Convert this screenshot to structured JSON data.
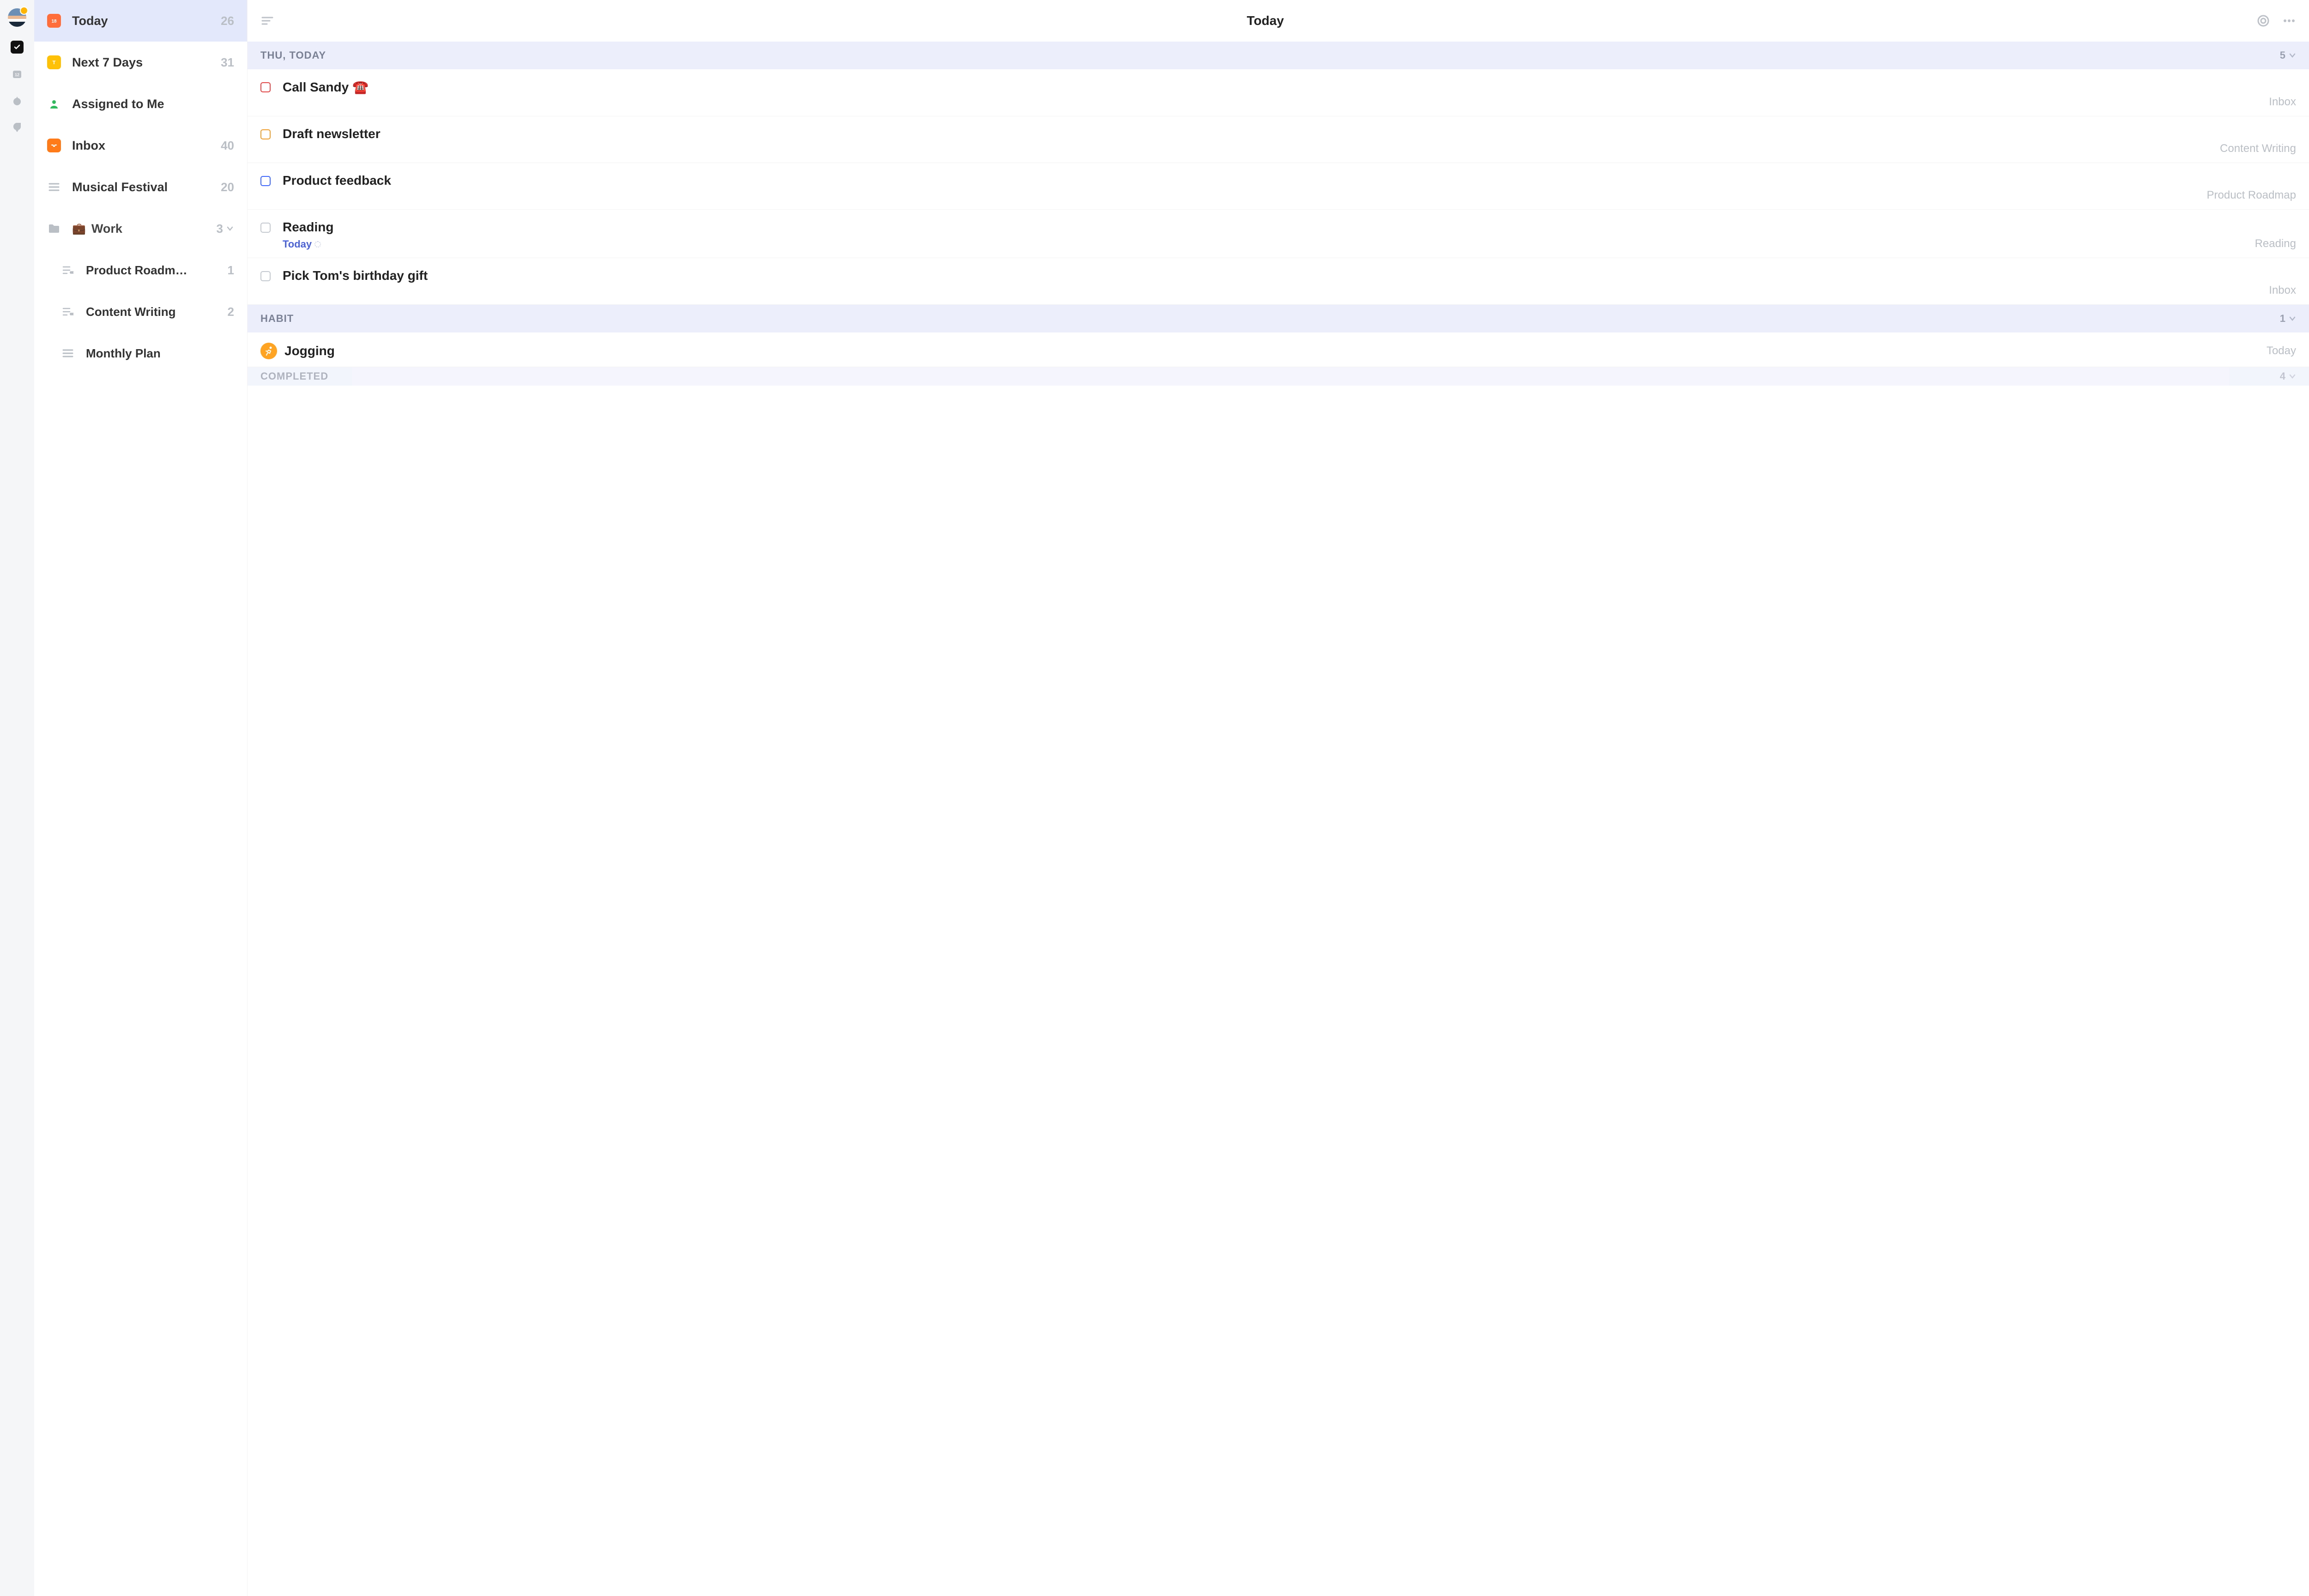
{
  "rail": {
    "items": [
      "tasks",
      "calendar",
      "star",
      "clock"
    ]
  },
  "sidebar": {
    "items": [
      {
        "label": "Today",
        "count": "26",
        "icon": "day-18",
        "color": "red",
        "selected": true
      },
      {
        "label": "Next 7 Days",
        "count": "31",
        "icon": "week",
        "color": "yellow"
      },
      {
        "label": "Assigned to Me",
        "count": "",
        "icon": "person",
        "color": "green"
      },
      {
        "label": "Inbox",
        "count": "40",
        "icon": "inbox",
        "color": "orange"
      },
      {
        "label": "Musical Festival",
        "count": "20",
        "icon": "list",
        "color": "gray"
      }
    ],
    "groups": [
      {
        "emoji": "💼",
        "label": "Work",
        "count": "3",
        "children": [
          {
            "label": "Product Roadm…",
            "count": "1"
          },
          {
            "label": "Content Writing",
            "count": "2"
          },
          {
            "label": "Monthly Plan",
            "count": ""
          }
        ]
      }
    ]
  },
  "header": {
    "title": "Today"
  },
  "sections": [
    {
      "label": "THU, TODAY",
      "count": "5",
      "tasks": [
        {
          "title": "Call Sandy ☎️",
          "priority": "red",
          "list": "Inbox"
        },
        {
          "title": "Draft newsletter",
          "priority": "orange",
          "list": "Content Writing"
        },
        {
          "title": "Product feedback",
          "priority": "blue",
          "list": "Product Roadmap"
        },
        {
          "title": "Reading",
          "priority": "gray",
          "list": "Reading",
          "sub": "Today"
        },
        {
          "title": "Pick Tom's birthday gift",
          "priority": "gray",
          "list": "Inbox"
        }
      ]
    },
    {
      "label": "HABIT",
      "count": "1",
      "tasks": [
        {
          "title": "Jogging",
          "habit": true,
          "list": "Today"
        }
      ]
    },
    {
      "label": "COMPLETED",
      "count": "4",
      "tasks": []
    }
  ]
}
